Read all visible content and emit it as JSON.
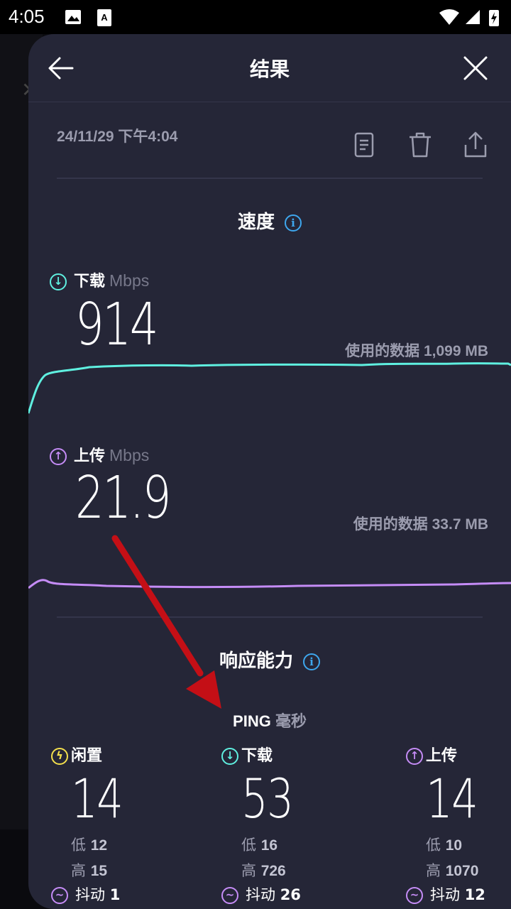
{
  "status_bar": {
    "time": "4:05"
  },
  "header": {
    "title": "结果"
  },
  "result": {
    "timestamp": "24/11/29 下午4:04"
  },
  "speed": {
    "title": "速度",
    "download": {
      "label": "下载",
      "unit": "Mbps",
      "value": "914",
      "data_used": "使用的数据 1,099 MB"
    },
    "upload": {
      "label": "上传",
      "unit": "Mbps",
      "value": "21.9",
      "data_used": "使用的数据 33.7 MB"
    }
  },
  "responsiveness": {
    "title": "响应能力",
    "ping_label": "PING",
    "ping_unit": "毫秒",
    "columns": [
      {
        "label": "闲置",
        "value": "14",
        "low_label": "低",
        "low": "12",
        "high_label": "高",
        "high": "15",
        "jitter_label": "抖动",
        "jitter": "1"
      },
      {
        "label": "下载",
        "value": "53",
        "low_label": "低",
        "low": "16",
        "high_label": "高",
        "high": "726",
        "jitter_label": "抖动",
        "jitter": "26"
      },
      {
        "label": "上传",
        "value": "14",
        "low_label": "低",
        "low": "10",
        "high_label": "高",
        "high": "1070",
        "jitter_label": "抖动",
        "jitter": "12"
      }
    ]
  },
  "colors": {
    "download": "#5ff0e0",
    "upload": "#c58cf6",
    "idle": "#f4e04d",
    "info": "#3ea7ee",
    "arrow": "#c40f16"
  }
}
